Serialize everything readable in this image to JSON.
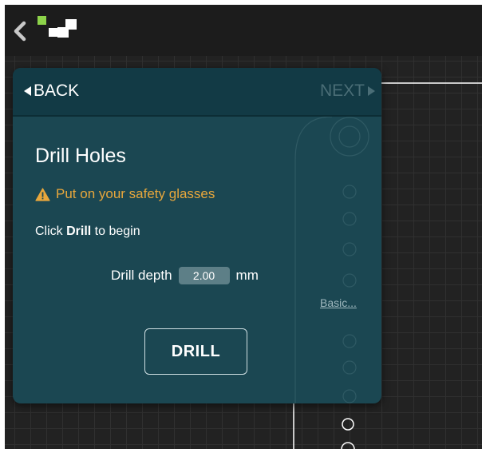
{
  "app": {
    "icons": {
      "back": "chevron-left-icon",
      "logo": "app-logo-icon",
      "warning": "warning-triangle-icon"
    }
  },
  "panel": {
    "nav": {
      "back_label": "BACK",
      "next_label": "NEXT"
    },
    "title": "Drill Holes",
    "warning_text": "Put on your safety glasses",
    "instruction": {
      "prefix": "Click ",
      "action": "Drill",
      "suffix": " to begin"
    },
    "depth": {
      "label": "Drill depth",
      "value": "2.00",
      "unit": "mm"
    },
    "basic_link": "Basic...",
    "drill_button": "DRILL"
  },
  "colors": {
    "panel_bg": "#1b4752",
    "nav_bg": "#123a45",
    "warning": "#e8a73c",
    "logo_green": "#8dd34a",
    "next_disabled": "#4a6d76",
    "canvas_bg": "#222222"
  }
}
